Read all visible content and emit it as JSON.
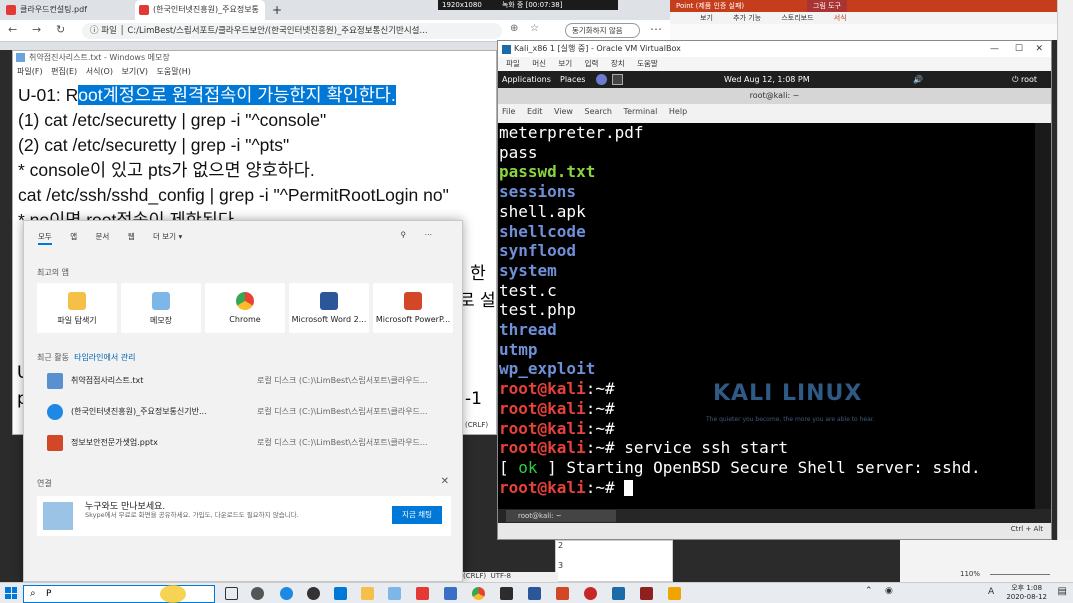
{
  "browser": {
    "tabs": [
      "클라우드컨설팅.pdf",
      "(한국인터넷진흥원)_주요정보통",
      "+"
    ],
    "address": "C:/LimBest/스립서포트/클라우드보안/(한국인터넷진흥원)_주요정보통신기반시설...",
    "file_label": "파일",
    "profile_label": "동기화하지 않음"
  },
  "recorder": {
    "size": "1920x1080",
    "time": "녹화 중 [00:07:38]"
  },
  "notepad": {
    "title": "취약점진사리스트.txt - Windows 메모장",
    "menu": [
      "파일(F)",
      "편집(E)",
      "서식(O)",
      "보기(V)",
      "도움말(H)"
    ],
    "line1_prefix": "U-01: R",
    "line1_selected": "oot계정으로 원격접속이 가능한지 확인한다.",
    "lines": [
      "(1) cat /etc/securetty | grep -i \"^console\"",
      "(2) cat /etc/securetty | grep -i \"^pts\"",
      "* console이 있고 pts가 없으면 양호하다.",
      "cat /etc/ssh/sshd_config | grep -i \"^PermitRootLogin no\"",
      "* no이면 root접속이 제한된다."
    ],
    "fragments": [
      ": 한",
      "로 설",
      "U",
      "p",
      "-1"
    ],
    "status": [
      "(CRLF)",
      "UTF-8"
    ]
  },
  "ppt": {
    "banner": "Point (제품 인증 실패)",
    "tabs": [
      "보기",
      "추가 기능",
      "스토리보드",
      "서식"
    ],
    "context_tab": "그림 도구",
    "zoom": "110%"
  },
  "vbox": {
    "title": "Kali_x86 1 [실행 중] - Oracle VM VirtualBox",
    "menu": [
      "파일",
      "머신",
      "보기",
      "입력",
      "장치",
      "도움말"
    ],
    "kali_panel": {
      "applications": "Applications",
      "places": "Places",
      "clock": "Wed Aug 12, 1:08 PM",
      "user": "root"
    },
    "terminal_title": "root@kali: ~",
    "terminal_menu": [
      "File",
      "Edit",
      "View",
      "Search",
      "Terminal",
      "Help"
    ],
    "files": [
      {
        "name": "meterpreter.pdf",
        "kind": "file"
      },
      {
        "name": "pass",
        "kind": "file"
      },
      {
        "name": "passwd.txt",
        "kind": "exe"
      },
      {
        "name": "sessions",
        "kind": "dir"
      },
      {
        "name": "shell.apk",
        "kind": "file"
      },
      {
        "name": "shellcode",
        "kind": "dir"
      },
      {
        "name": "synflood",
        "kind": "dir"
      },
      {
        "name": "system",
        "kind": "dir"
      },
      {
        "name": "test.c",
        "kind": "file"
      },
      {
        "name": "test.php",
        "kind": "file"
      },
      {
        "name": "thread",
        "kind": "dir"
      },
      {
        "name": "utmp",
        "kind": "dir"
      },
      {
        "name": "wp_exploit",
        "kind": "dir"
      }
    ],
    "prompt_user": "root@kali",
    "prompt_suffix": ":~#",
    "command": " service ssh start",
    "ok_open": "[ ",
    "ok_word": "ok",
    "ok_close": " ] Starting OpenBSD Secure Shell server: sshd.",
    "logo_text": "KALI LINUX",
    "logo_tagline": "The quieter you become, the more you are able to hear.",
    "taskbar_item": "root@kali: ~",
    "status_host": "Ctrl + Alt"
  },
  "start_menu": {
    "tabs": [
      "모두",
      "앱",
      "문서",
      "웹",
      "더 보기 ▾"
    ],
    "top_apps_label": "최고의 앱",
    "apps": [
      {
        "name": "파일 탐색기",
        "color": "#f4c04a"
      },
      {
        "name": "메모장",
        "color": "#7db7e8"
      },
      {
        "name": "Chrome",
        "color": "#e94235"
      },
      {
        "name": "Microsoft Word 2...",
        "color": "#2b579a"
      },
      {
        "name": "Microsoft PowerP...",
        "color": "#d24726"
      }
    ],
    "recent_label": "최근 활동",
    "recent_link": "타임라인에서 관리",
    "recent": [
      {
        "name": "취약점점사리스트.txt",
        "path": "로컬 디스크 (C:)\\LimBest\\스립서포트\\클라우드...",
        "color": "#5a8fd0"
      },
      {
        "name": "(한국인터넷진흥원)_주요정보통신기반...",
        "path": "로컬 디스크 (C:)\\LimBest\\스립서포트\\클라우드...",
        "color": "#1e88e5"
      },
      {
        "name": "정보보안전문가셋업.pptx",
        "path": "로컬 디스크 (C:)\\LimBest\\스립서포트\\클라우드...",
        "color": "#d24726"
      }
    ],
    "contacts_label": "연결",
    "promo_title": "누구와도 만나보세요.",
    "promo_body": "Skype에서 무료로 화면을 공유하세요. 가입도, 다운로드도 필요하지 않습니다.",
    "promo_button": "지금 채팅"
  },
  "taskbar": {
    "search_value": "P",
    "clock_time": "오후 1:08",
    "clock_date": "2020-08-12",
    "ime": "A"
  }
}
